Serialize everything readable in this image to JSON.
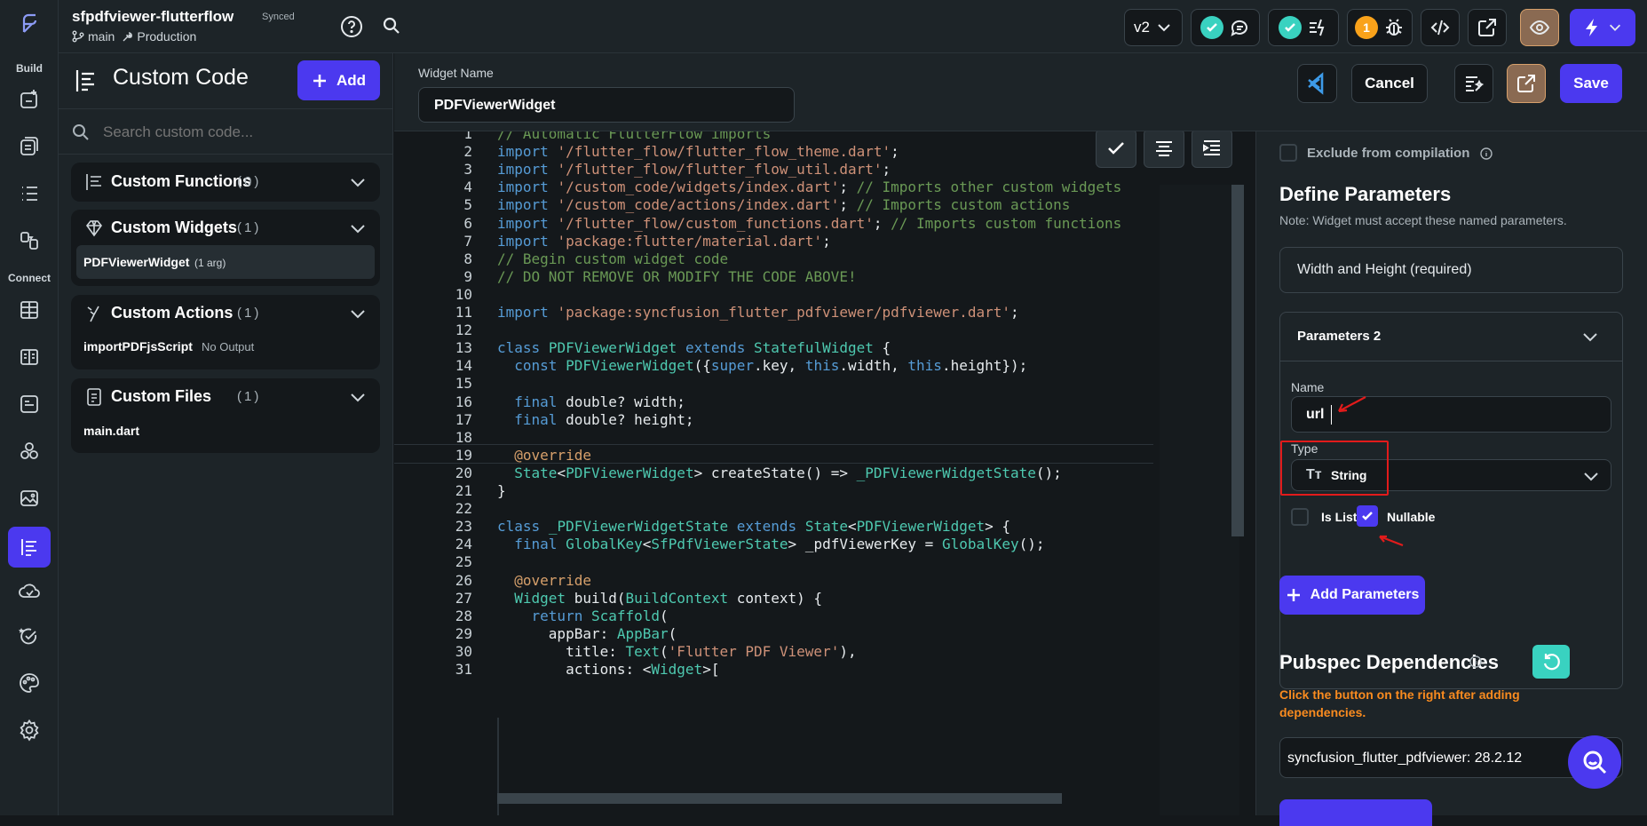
{
  "project": {
    "name": "sfpdfviewer-flutterflow",
    "sync_status": "Synced",
    "branch": "main",
    "environment": "Production"
  },
  "rail": {
    "build_label": "Build",
    "connect_label": "Connect"
  },
  "topbar": {
    "version": "v2",
    "warning_count": "1"
  },
  "leftpanel": {
    "title": "Custom Code",
    "add_label": "Add",
    "search_placeholder": "Search custom code...",
    "sections": {
      "functions": {
        "title": "Custom Functions",
        "count": "(0)"
      },
      "widgets": {
        "title": "Custom Widgets",
        "count": "(1)",
        "item": {
          "name": "PDFViewerWidget",
          "meta": "(1 arg)"
        }
      },
      "actions": {
        "title": "Custom Actions",
        "count": "(1)",
        "item": {
          "name": "importPDFjsScript",
          "meta": "No Output"
        }
      },
      "files": {
        "title": "Custom Files",
        "count": "(1)",
        "item": {
          "name": "main.dart"
        }
      }
    }
  },
  "editorhead": {
    "label": "Widget Name",
    "value": "PDFViewerWidget",
    "cancel_label": "Cancel",
    "save_label": "Save"
  },
  "code": {
    "line_numbers": [
      "1",
      "2",
      "3",
      "4",
      "5",
      "6",
      "7",
      "8",
      "9",
      "10",
      "11",
      "12",
      "13",
      "14",
      "15",
      "16",
      "17",
      "18",
      "19",
      "20",
      "21",
      "22",
      "23",
      "24",
      "25",
      "26",
      "27",
      "28",
      "29",
      "30",
      "31"
    ],
    "lines": [
      "// Automatic FlutterFlow imports",
      "import '/flutter_flow/flutter_flow_theme.dart';",
      "import '/flutter_flow/flutter_flow_util.dart';",
      "import '/custom_code/widgets/index.dart'; // Imports other custom widgets",
      "import '/custom_code/actions/index.dart'; // Imports custom actions",
      "import '/flutter_flow/custom_functions.dart'; // Imports custom functions",
      "import 'package:flutter/material.dart';",
      "// Begin custom widget code",
      "// DO NOT REMOVE OR MODIFY THE CODE ABOVE!",
      "",
      "import 'package:syncfusion_flutter_pdfviewer/pdfviewer.dart';",
      "",
      "class PDFViewerWidget extends StatefulWidget {",
      "  const PDFViewerWidget({super.key, this.width, this.height});",
      "",
      "  final double? width;",
      "  final double? height;",
      "",
      "  @override",
      "  State<PDFViewerWidget> createState() => _PDFViewerWidgetState();",
      "}",
      "",
      "class _PDFViewerWidgetState extends State<PDFViewerWidget> {",
      "  final GlobalKey<SfPdfViewerState> _pdfViewerKey = GlobalKey();",
      "",
      "  @override",
      "  Widget build(BuildContext context) {",
      "    return Scaffold(",
      "      appBar: AppBar(",
      "        title: Text('Flutter PDF Viewer'),",
      "        actions: <Widget>["
    ]
  },
  "rightpanel": {
    "exclude_label": "Exclude from compilation",
    "define_title": "Define Parameters",
    "define_note": "Note: Widget must accept these named parameters.",
    "width_height": "Width and Height (required)",
    "param_group": "Parameters 2",
    "name_label": "Name",
    "name_value": "url",
    "type_label": "Type",
    "type_value": "String",
    "is_list_label": "Is List",
    "nullable_label": "Nullable",
    "add_params_label": "Add Parameters",
    "pubspec_title": "Pubspec Dependencies",
    "pubspec_note": "Click the button on the right after adding dependencies.",
    "dependency_value": "syncfusion_flutter_pdfviewer: 28.2.12"
  },
  "colors": {
    "accent": "#4b39ef",
    "success": "#39d2c0",
    "warning": "#f9a21a",
    "orange_text": "#f98b1f",
    "highlight": "#e21b1b"
  }
}
